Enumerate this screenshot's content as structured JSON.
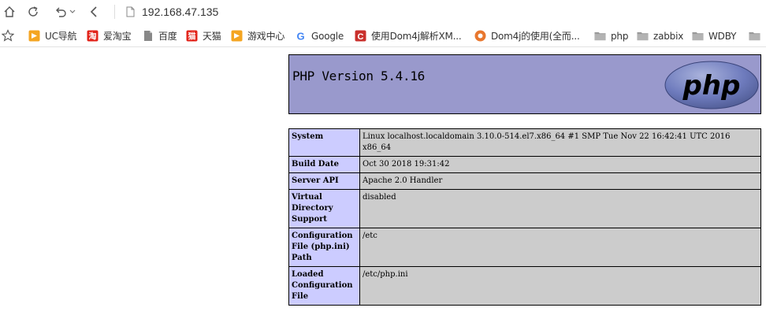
{
  "toolbar": {
    "url": "192.168.47.135"
  },
  "bookmarks": [
    {
      "label": "UC导航",
      "icon": "uc-nav-icon",
      "color": "#f4a522"
    },
    {
      "label": "爱淘宝",
      "icon": "aitaobao-icon",
      "color": "#e2231a"
    },
    {
      "label": "百度",
      "icon": "page-icon",
      "color": "#888888"
    },
    {
      "label": "天猫",
      "icon": "tmall-icon",
      "color": "#e2231a"
    },
    {
      "label": "游戏中心",
      "icon": "game-center-icon",
      "color": "#f4a522"
    },
    {
      "label": "Google",
      "icon": "google-icon",
      "color": "#4285f4"
    },
    {
      "label": "使用Dom4j解析XM...",
      "icon": "csdn-icon",
      "color": "#c9302c"
    },
    {
      "label": "Dom4j的使用(全而...",
      "icon": "blog-icon",
      "color": "#e8772e"
    },
    {
      "label": "php",
      "icon": "folder-icon",
      "color": "#8c8c8c"
    },
    {
      "label": "zabbix",
      "icon": "folder-icon",
      "color": "#8c8c8c"
    },
    {
      "label": "WDBY",
      "icon": "folder-icon",
      "color": "#8c8c8c"
    },
    {
      "label": "",
      "icon": "folder-icon",
      "color": "#8c8c8c"
    }
  ],
  "phpinfo": {
    "title": "PHP Version 5.4.16",
    "logo_text": "php",
    "rows": [
      {
        "key": "System",
        "value": "Linux localhost.localdomain 3.10.0-514.el7.x86_64 #1 SMP Tue Nov 22 16:42:41 UTC 2016 x86_64"
      },
      {
        "key": "Build Date",
        "value": "Oct 30 2018 19:31:42"
      },
      {
        "key": "Server API",
        "value": "Apache 2.0 Handler"
      },
      {
        "key": "Virtual Directory Support",
        "value": "disabled"
      },
      {
        "key": "Configuration File (php.ini) Path",
        "value": "/etc"
      },
      {
        "key": "Loaded Configuration File",
        "value": "/etc/php.ini"
      }
    ]
  },
  "colors": {
    "header_bg": "#9999cc",
    "key_bg": "#ccccff",
    "value_bg": "#cccccc"
  }
}
